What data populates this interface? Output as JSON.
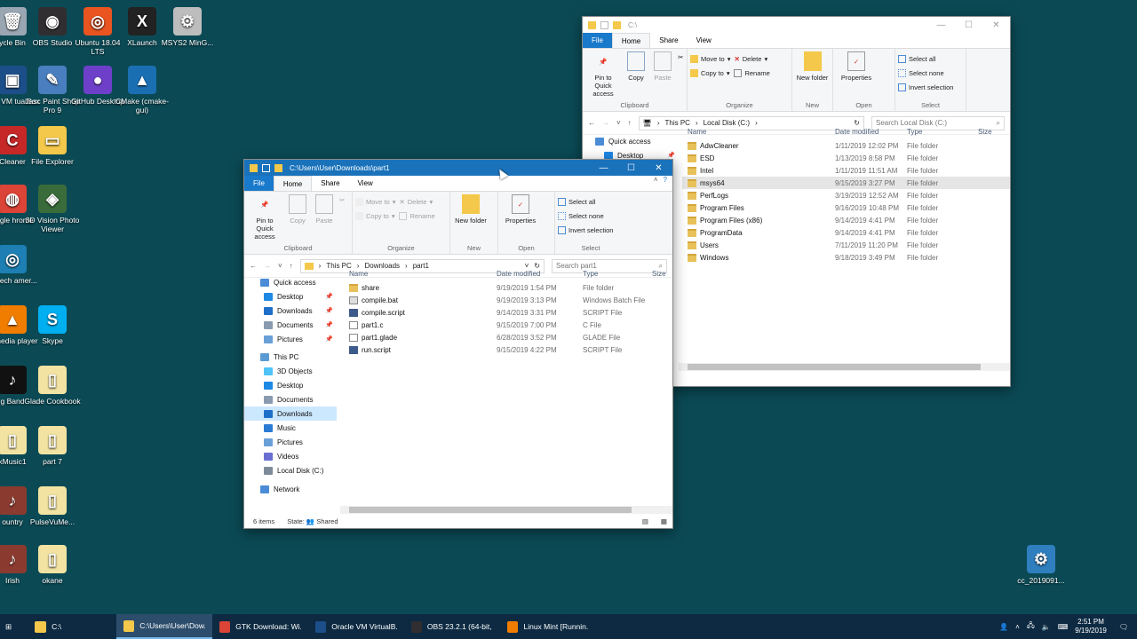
{
  "desktop": {
    "icons": [
      {
        "label": "ycle Bin",
        "color": "#9aa7b3",
        "glyph": "🗑"
      },
      {
        "label": "OBS Studio",
        "color": "#302e31",
        "glyph": "◉"
      },
      {
        "label": "Ubuntu 18.04 LTS",
        "color": "#e95420",
        "glyph": "◎"
      },
      {
        "label": "XLaunch",
        "color": "#222222",
        "glyph": "X"
      },
      {
        "label": "MSYS2 MinG...",
        "color": "#bdbdbd",
        "glyph": "⚙"
      },
      {
        "label": "acle VM tualBox",
        "color": "#1c4f8a",
        "glyph": "▣"
      },
      {
        "label": "Jasc Paint Shop Pro 9",
        "color": "#4a7fbf",
        "glyph": "✎"
      },
      {
        "label": "GitHub Desktop",
        "color": "#6e40c9",
        "glyph": "●"
      },
      {
        "label": "CMake (cmake-gui)",
        "color": "#1a6fb3",
        "glyph": "▲"
      },
      {
        "label": "Cleaner",
        "color": "#c62828",
        "glyph": "C"
      },
      {
        "label": "File Explorer",
        "color": "#f4c84a",
        "glyph": "▭"
      },
      {
        "label": "oogle hrome",
        "color": "#db4437",
        "glyph": "◍"
      },
      {
        "label": "3D Vision Photo Viewer",
        "color": "#3a6b3a",
        "glyph": "◈"
      },
      {
        "label": "egitech amer...",
        "color": "#1d7fb3",
        "glyph": "◎"
      },
      {
        "label": "C media player",
        "color": "#f07d00",
        "glyph": "▲"
      },
      {
        "label": "Skype",
        "color": "#00aff0",
        "glyph": "S"
      },
      {
        "label": "g Band",
        "color": "#111111",
        "glyph": "♪"
      },
      {
        "label": "Glade Cookbook",
        "color": "#f2e3a3",
        "glyph": "▯"
      },
      {
        "label": "kMusic1",
        "color": "#f2e3a3",
        "glyph": "▯"
      },
      {
        "label": "part 7",
        "color": "#f2e3a3",
        "glyph": "▯"
      },
      {
        "label": "ountry",
        "color": "#8b3a2f",
        "glyph": "♪"
      },
      {
        "label": "PulseVuMe...",
        "color": "#f2e3a3",
        "glyph": "▯"
      },
      {
        "label": "Irish",
        "color": "#8b3a2f",
        "glyph": "♪"
      },
      {
        "label": "okane",
        "color": "#f2e3a3",
        "glyph": "▯"
      },
      {
        "label": "cc_2019091...",
        "color": "#2f7fbf",
        "glyph": "⚙"
      }
    ]
  },
  "win_c": {
    "title": "C:\\",
    "tabs": [
      "File",
      "Home",
      "Share",
      "View"
    ],
    "ribbon": {
      "pin": "Pin to Quick access",
      "copy": "Copy",
      "paste": "Paste",
      "clipboard": "Clipboard",
      "move_to": "Move to",
      "copy_to": "Copy to",
      "delete": "Delete",
      "rename": "Rename",
      "organize": "Organize",
      "new_folder": "New folder",
      "new": "New",
      "properties": "Properties",
      "open": "Open",
      "select_all": "Select all",
      "select_none": "Select none",
      "invert": "Invert selection",
      "select": "Select"
    },
    "path": [
      "This PC",
      "Local Disk (C:)"
    ],
    "search_placeholder": "Search Local Disk (C:)",
    "nav": [
      "Quick access",
      "Desktop"
    ],
    "columns": [
      "Name",
      "Date modified",
      "Type",
      "Size"
    ],
    "rows": [
      {
        "name": "AdwCleaner",
        "date": "1/11/2019 12:02 PM",
        "type": "File folder"
      },
      {
        "name": "ESD",
        "date": "1/13/2019 8:58 PM",
        "type": "File folder"
      },
      {
        "name": "Intel",
        "date": "1/11/2019 11:51 AM",
        "type": "File folder"
      },
      {
        "name": "msys64",
        "date": "9/15/2019 3:27 PM",
        "type": "File folder"
      },
      {
        "name": "PerfLogs",
        "date": "3/19/2019 12:52 AM",
        "type": "File folder"
      },
      {
        "name": "Program Files",
        "date": "9/16/2019 10:48 PM",
        "type": "File folder"
      },
      {
        "name": "Program Files (x86)",
        "date": "9/14/2019 4:41 PM",
        "type": "File folder"
      },
      {
        "name": "ProgramData",
        "date": "9/14/2019 4:41 PM",
        "type": "File folder"
      },
      {
        "name": "Users",
        "date": "7/11/2019 11:20 PM",
        "type": "File folder"
      },
      {
        "name": "Windows",
        "date": "9/18/2019 3:49 PM",
        "type": "File folder"
      }
    ]
  },
  "win_part1": {
    "title": "C:\\Users\\User\\Downloads\\part1",
    "tabs": [
      "File",
      "Home",
      "Share",
      "View"
    ],
    "ribbon": {
      "pin": "Pin to Quick access",
      "copy": "Copy",
      "paste": "Paste",
      "clipboard": "Clipboard",
      "move_to": "Move to",
      "copy_to": "Copy to",
      "delete": "Delete",
      "rename": "Rename",
      "organize": "Organize",
      "new_folder": "New folder",
      "new": "New",
      "properties": "Properties",
      "open": "Open",
      "select_all": "Select all",
      "select_none": "Select none",
      "invert": "Invert selection",
      "select": "Select"
    },
    "path": [
      "This PC",
      "Downloads",
      "part1"
    ],
    "search_placeholder": "Search part1",
    "nav": {
      "quick_access": "Quick access",
      "quick_items": [
        "Desktop",
        "Downloads",
        "Documents",
        "Pictures"
      ],
      "this_pc": "This PC",
      "pc_items": [
        "3D Objects",
        "Desktop",
        "Documents",
        "Downloads",
        "Music",
        "Pictures",
        "Videos",
        "Local Disk (C:)"
      ],
      "network": "Network"
    },
    "columns": [
      "Name",
      "Date modified",
      "Type",
      "Size"
    ],
    "rows": [
      {
        "name": "share",
        "date": "9/19/2019 1:54 PM",
        "type": "File folder",
        "icon": "folder"
      },
      {
        "name": "compile.bat",
        "date": "9/19/2019 3:13 PM",
        "type": "Windows Batch File",
        "icon": "bat"
      },
      {
        "name": "compile.script",
        "date": "9/14/2019 3:31 PM",
        "type": "SCRIPT File",
        "icon": "script"
      },
      {
        "name": "part1.c",
        "date": "9/15/2019 7:00 PM",
        "type": "C File",
        "icon": "doc"
      },
      {
        "name": "part1.glade",
        "date": "6/28/2019 3:52 PM",
        "type": "GLADE File",
        "icon": "doc"
      },
      {
        "name": "run.script",
        "date": "9/15/2019 4:22 PM",
        "type": "SCRIPT File",
        "icon": "script"
      }
    ],
    "status_items": "6 items",
    "status_state": "State:",
    "status_shared": "Shared"
  },
  "taskbar": {
    "items": [
      {
        "label": "C:\\",
        "color": "#f4c84a",
        "active": false
      },
      {
        "label": "C:\\Users\\User\\Dow...",
        "color": "#f4c84a",
        "active": true
      },
      {
        "label": "GTK Download: Wi...",
        "color": "#db4437",
        "active": false
      },
      {
        "label": "Oracle VM VirtualB...",
        "color": "#1c4f8a",
        "active": false
      },
      {
        "label": "OBS 23.2.1 (64-bit, ...",
        "color": "#302e31",
        "active": false
      },
      {
        "label": "Linux Mint [Runnin...",
        "color": "#f07d00",
        "active": false
      }
    ],
    "time": "2:51 PM",
    "date": "9/19/2019"
  }
}
